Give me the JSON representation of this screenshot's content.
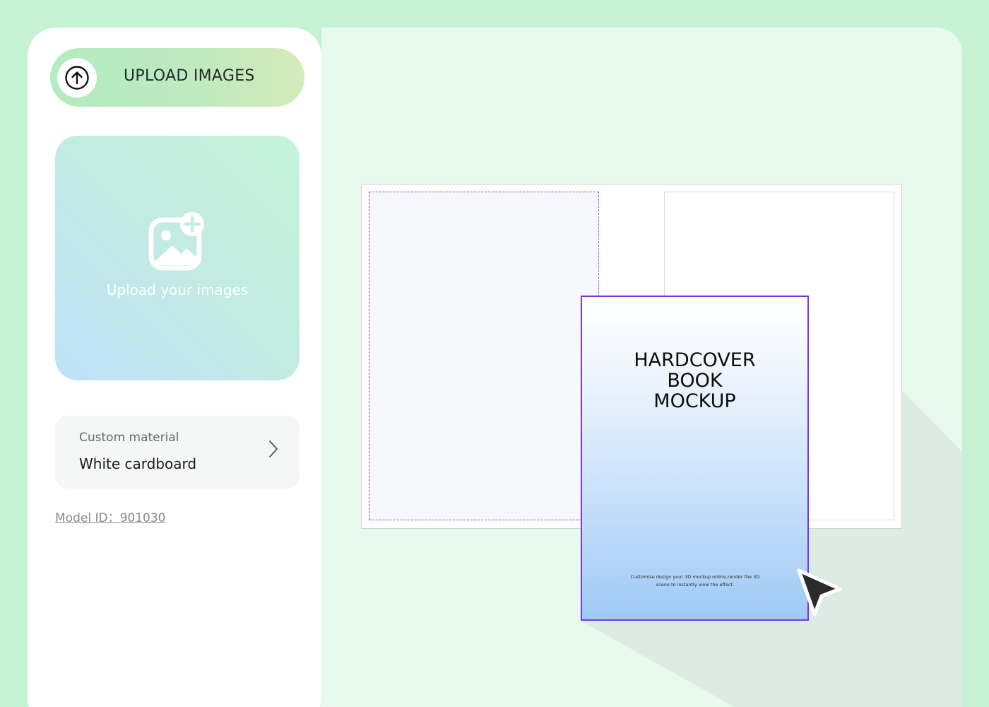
{
  "sidebar": {
    "upload_button": {
      "label": "UPLOAD IMAGES",
      "icon": "upload-arrow-icon"
    },
    "dropzone": {
      "text": "Upload your images",
      "icon": "image-add-icon"
    },
    "material": {
      "caption": "Custom material",
      "value": "White cardboard",
      "icon": "chevron-right-icon"
    },
    "model_id": {
      "label": "Model ID：",
      "value": "901030"
    }
  },
  "canvas": {
    "cover_title": "HARDCOVER\nBOOK\nMOCKUP",
    "cover_subtitle": "Customise design your 3D mockup online,render the 3D scene to instantly view the effect.",
    "cursor_icon": "pointer-cursor-icon"
  },
  "colors": {
    "background": "#c5f2d3",
    "stage": "#e8f9ee",
    "accent_purple": "#7a35e6",
    "upload_gradient_start": "#b2ecc0",
    "upload_gradient_end": "#d4eab9"
  }
}
